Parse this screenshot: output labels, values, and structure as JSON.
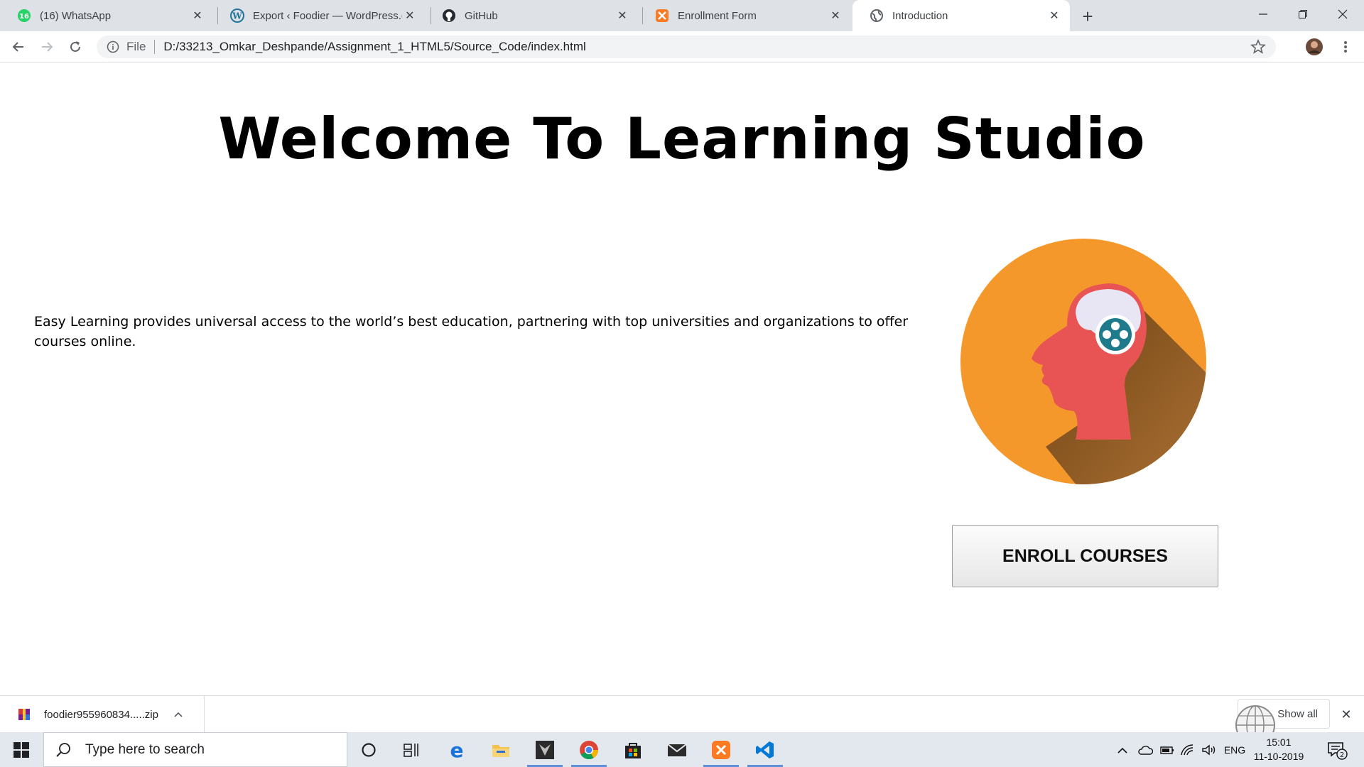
{
  "browser": {
    "tabs": [
      {
        "title": "(16) WhatsApp",
        "favicon": "whatsapp-icon",
        "badge": "16"
      },
      {
        "title": "Export ‹ Foodier — WordPress.co",
        "favicon": "wordpress-icon"
      },
      {
        "title": "GitHub",
        "favicon": "github-icon"
      },
      {
        "title": "Enrollment Form",
        "favicon": "xampp-icon"
      },
      {
        "title": "Introduction",
        "favicon": "globe-icon",
        "active": true
      }
    ],
    "address": {
      "protocol_label": "File",
      "url": "D:/33213_Omkar_Deshpande/Assignment_1_HTML5/Source_Code/index.html"
    }
  },
  "page": {
    "heading": "Welcome To Learning Studio",
    "intro": "Easy Learning provides universal access to the world’s best education, partnering with top universities and organizations to offer courses online.",
    "enroll_button": "ENROLL COURSES",
    "accent_color": "#f4982c"
  },
  "downloads": {
    "file_name": "foodier955960834.....zip",
    "show_all": "Show all"
  },
  "taskbar": {
    "search_placeholder": "Type here to search",
    "language": "ENG",
    "time": "15:01",
    "date": "11-10-2019",
    "notification_count": "2"
  }
}
